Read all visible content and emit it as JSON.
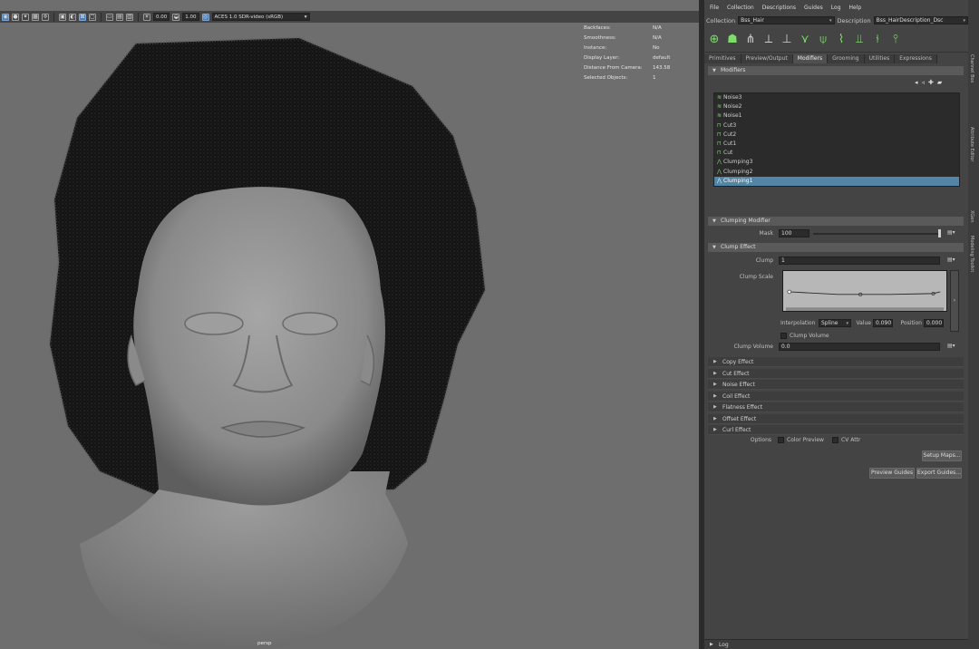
{
  "viewport": {
    "toolbar": {
      "exposure": "0.00",
      "gamma": "1.00",
      "colorspace": "ACES 1.0 SDR-video (sRGB)"
    },
    "hud": [
      {
        "label": "Backfaces:",
        "value": "N/A"
      },
      {
        "label": "Smoothness:",
        "value": "N/A"
      },
      {
        "label": "Instance:",
        "value": "No"
      },
      {
        "label": "Display Layer:",
        "value": "default"
      },
      {
        "label": "Distance From Camera:",
        "value": "143.58"
      },
      {
        "label": "Selected Objects:",
        "value": "1"
      }
    ],
    "camera": "persp"
  },
  "panel": {
    "menu": [
      "File",
      "Collection",
      "Descriptions",
      "Guides",
      "Log",
      "Help"
    ],
    "collection_label": "Collection",
    "collection_value": "Bss_Hair",
    "description_label": "Description",
    "description_value": "Bss_HairDescription_Dsc",
    "tabs": [
      "Primitives",
      "Preview/Output",
      "Modifiers",
      "Grooming",
      "Utilities",
      "Expressions"
    ],
    "modifiers_title": "Modifiers",
    "modifiers": [
      {
        "name": "Noise3",
        "selected": false
      },
      {
        "name": "Noise2",
        "selected": false
      },
      {
        "name": "Noise1",
        "selected": false
      },
      {
        "name": "Cut3",
        "selected": false
      },
      {
        "name": "Cut2",
        "selected": false
      },
      {
        "name": "Cut1",
        "selected": false
      },
      {
        "name": "Cut",
        "selected": false
      },
      {
        "name": "Clumping3",
        "selected": false
      },
      {
        "name": "Clumping2",
        "selected": false
      },
      {
        "name": "Clumping1",
        "selected": true
      }
    ],
    "clumping_modifier_title": "Clumping Modifier",
    "mask_label": "Mask",
    "mask_value": "100",
    "clump_effect_title": "Clump Effect",
    "clump_label": "Clump",
    "clump_value": "1",
    "clump_scale_label": "Clump Scale",
    "interp_label": "Interpolation",
    "interp_value": "Spline",
    "value_label": "Value",
    "value_value": "0.090",
    "position_label": "Position",
    "position_value": "0.000",
    "clump_volume_check_label": "Clump Volume",
    "clump_volume_label": "Clump Volume",
    "clump_volume_value": "0.0",
    "effects": [
      "Copy Effect",
      "Cut Effect",
      "Noise Effect",
      "Coil Effect",
      "Flatness Effect",
      "Offset Effect",
      "Curl Effect"
    ],
    "options_label": "Options",
    "color_preview_label": "Color Preview",
    "cv_attr_label": "CV Attr",
    "setup_button": "Setup Maps...",
    "preview_guides_button": "Preview Guides",
    "export_guides_button": "Export Guides...",
    "log_label": "Log"
  },
  "side_strip": [
    "Channel Box",
    "Attribute Editor",
    "XGen",
    "Modeling Toolkit"
  ]
}
